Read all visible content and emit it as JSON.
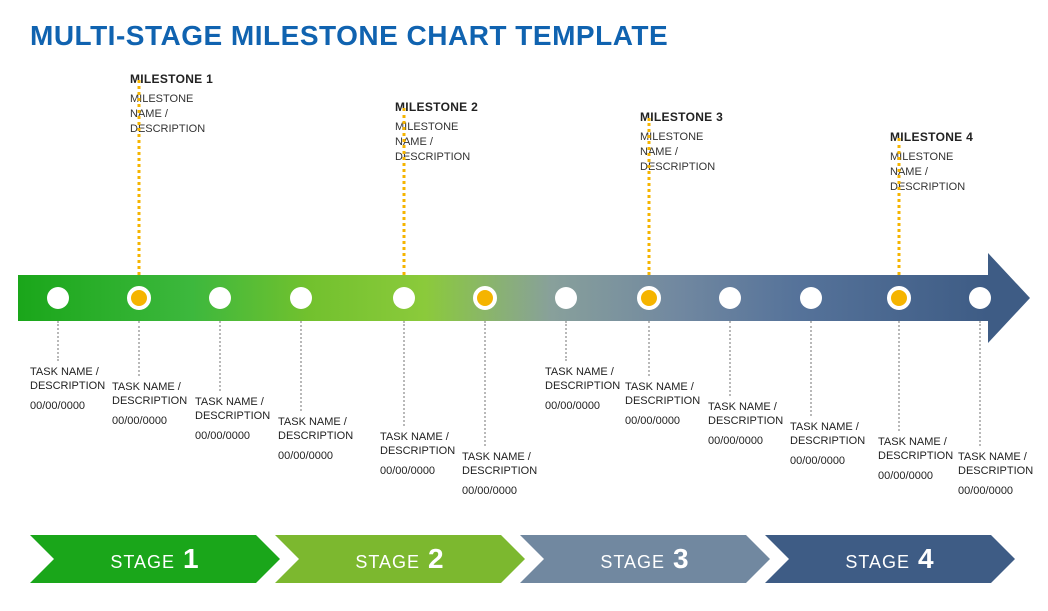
{
  "title": "MULTI-STAGE MILESTONE CHART TEMPLATE",
  "milestones": [
    {
      "label": "MILESTONE 1",
      "desc": "MILESTONE NAME / DESCRIPTION"
    },
    {
      "label": "MILESTONE 2",
      "desc": "MILESTONE NAME / DESCRIPTION"
    },
    {
      "label": "MILESTONE 3",
      "desc": "MILESTONE NAME / DESCRIPTION"
    },
    {
      "label": "MILESTONE 4",
      "desc": "MILESTONE NAME / DESCRIPTION"
    }
  ],
  "tasks": [
    {
      "name": "TASK NAME / DESCRIPTION",
      "date": "00/00/0000"
    },
    {
      "name": "TASK NAME / DESCRIPTION",
      "date": "00/00/0000"
    },
    {
      "name": "TASK NAME / DESCRIPTION",
      "date": "00/00/0000"
    },
    {
      "name": "TASK NAME / DESCRIPTION",
      "date": "00/00/0000"
    },
    {
      "name": "TASK NAME / DESCRIPTION",
      "date": "00/00/0000"
    },
    {
      "name": "TASK NAME / DESCRIPTION",
      "date": "00/00/0000"
    },
    {
      "name": "TASK NAME / DESCRIPTION",
      "date": "00/00/0000"
    },
    {
      "name": "TASK NAME / DESCRIPTION",
      "date": "00/00/0000"
    },
    {
      "name": "TASK NAME / DESCRIPTION",
      "date": "00/00/0000"
    },
    {
      "name": "TASK NAME / DESCRIPTION",
      "date": "00/00/0000"
    },
    {
      "name": "TASK NAME / DESCRIPTION",
      "date": "00/00/0000"
    },
    {
      "name": "TASK NAME / DESCRIPTION",
      "date": "00/00/0000"
    }
  ],
  "stages": [
    {
      "word": "STAGE",
      "num": "1",
      "color": "#1aa61a"
    },
    {
      "word": "STAGE",
      "num": "2",
      "color": "#7cb82f"
    },
    {
      "word": "STAGE",
      "num": "3",
      "color": "#7188a0"
    },
    {
      "word": "STAGE",
      "num": "4",
      "color": "#3e5c85"
    }
  ],
  "chart_data": {
    "type": "timeline",
    "title": "MULTI-STAGE MILESTONE CHART TEMPLATE",
    "dots": 12,
    "milestone_dot_indices": [
      1,
      4,
      7,
      10
    ],
    "milestones": [
      "MILESTONE 1",
      "MILESTONE 2",
      "MILESTONE 3",
      "MILESTONE 4"
    ],
    "stages": [
      "STAGE 1",
      "STAGE 2",
      "STAGE 3",
      "STAGE 4"
    ]
  }
}
